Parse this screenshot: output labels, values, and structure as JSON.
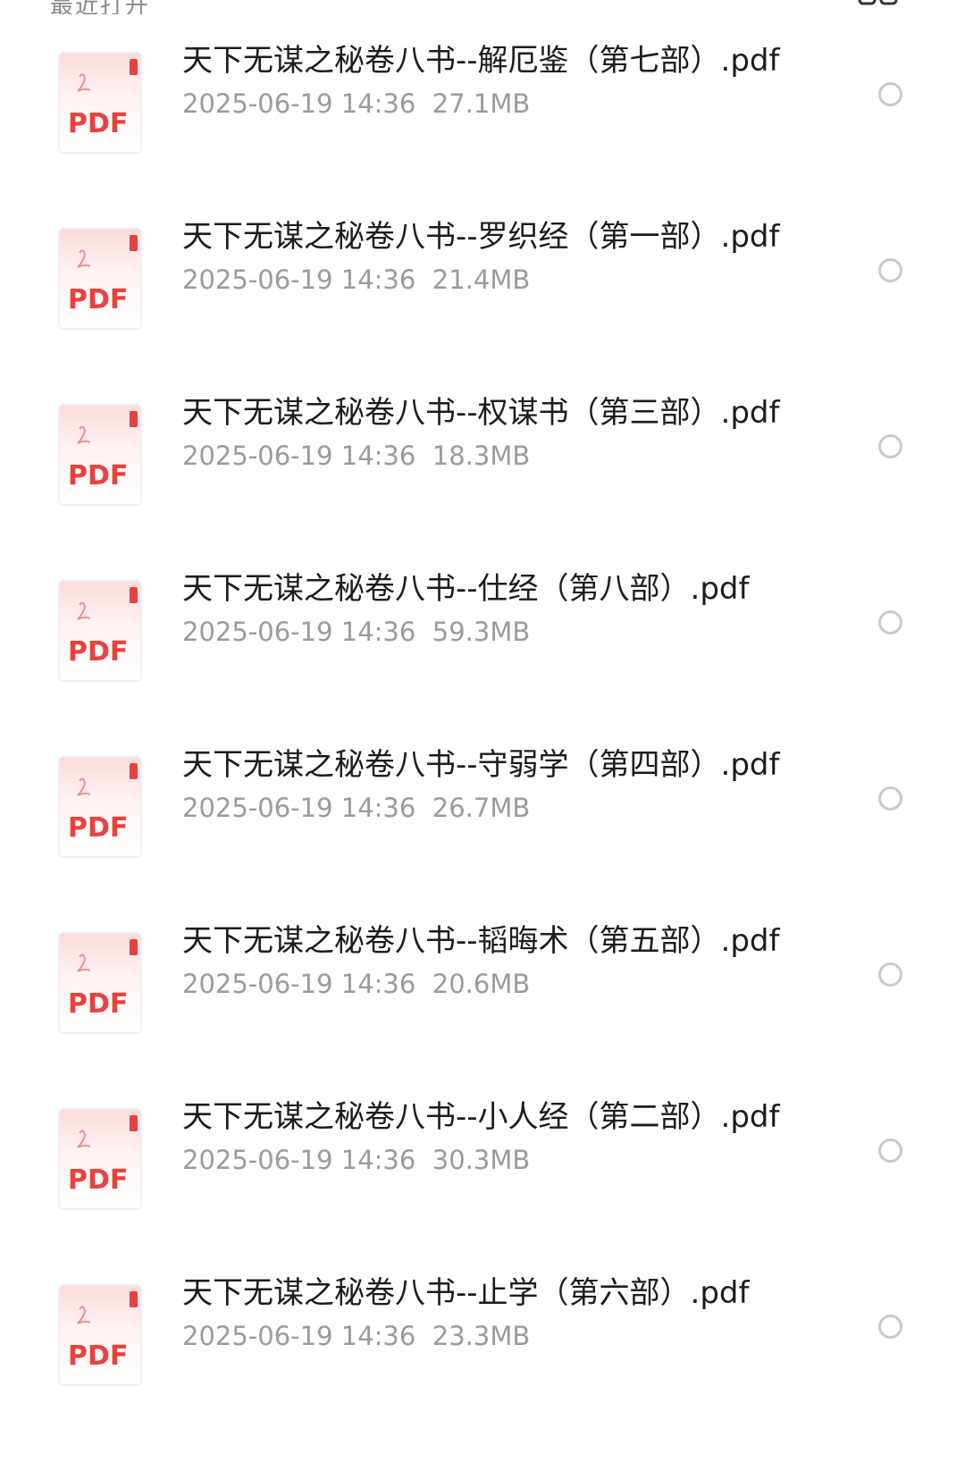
{
  "header": {
    "partial_title": "最近打开",
    "view_icon": "grid-view-icon"
  },
  "icon_label": "PDF",
  "colors": {
    "pdf_red": "#e8413e",
    "title_text": "#1c1c1c",
    "meta_text": "#9b9b9b",
    "radio_border": "#c9c9c9"
  },
  "files": [
    {
      "name": "天下无谋之秘卷八书--解厄鉴（第七部）.pdf",
      "date": "2025-06-19 14:36",
      "size": "27.1MB"
    },
    {
      "name": "天下无谋之秘卷八书--罗织经（第一部）.pdf",
      "date": "2025-06-19 14:36",
      "size": "21.4MB"
    },
    {
      "name": "天下无谋之秘卷八书--权谋书（第三部）.pdf",
      "date": "2025-06-19 14:36",
      "size": "18.3MB"
    },
    {
      "name": "天下无谋之秘卷八书--仕经（第八部）.pdf",
      "date": "2025-06-19 14:36",
      "size": "59.3MB"
    },
    {
      "name": "天下无谋之秘卷八书--守弱学（第四部）.pdf",
      "date": "2025-06-19 14:36",
      "size": "26.7MB"
    },
    {
      "name": "天下无谋之秘卷八书--韬晦术（第五部）.pdf",
      "date": "2025-06-19 14:36",
      "size": "20.6MB"
    },
    {
      "name": "天下无谋之秘卷八书--小人经（第二部）.pdf",
      "date": "2025-06-19 14:36",
      "size": "30.3MB"
    },
    {
      "name": "天下无谋之秘卷八书--止学（第六部）.pdf",
      "date": "2025-06-19 14:36",
      "size": "23.3MB"
    }
  ]
}
